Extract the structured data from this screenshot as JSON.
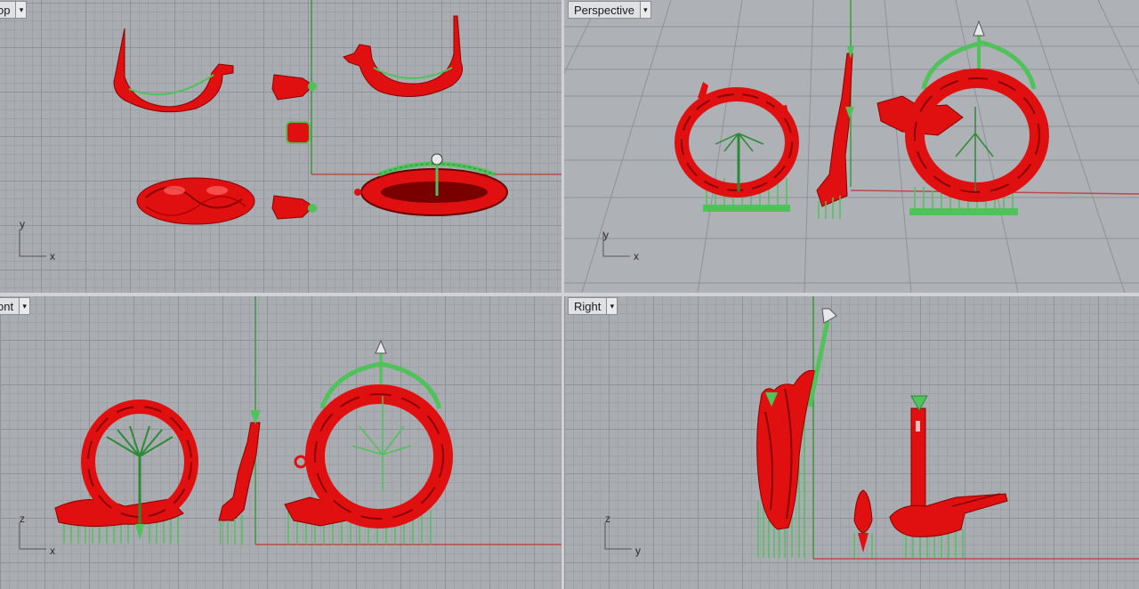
{
  "viewports": {
    "top": {
      "label": "op",
      "axes": {
        "x": "x",
        "y": "y"
      }
    },
    "perspective": {
      "label": "Perspective",
      "axes": {
        "x": "x",
        "y": "y"
      }
    },
    "front": {
      "label": "ont",
      "axes": {
        "x": "x",
        "y": "z"
      }
    },
    "right": {
      "label": "Right",
      "axes": {
        "x": "y",
        "y": "z"
      }
    }
  },
  "dropdown_glyph": "▾",
  "colors": {
    "model": "#e01010",
    "model_dark": "#8a0000",
    "support": "#4fc25a",
    "support_dark": "#2a8a36",
    "axis_x": "#c04848",
    "axis_y": "#3a9a3a",
    "tip": "#e8e8e8"
  },
  "icons": [
    "dropdown-arrow-icon",
    "axis-gizmo-icon"
  ]
}
